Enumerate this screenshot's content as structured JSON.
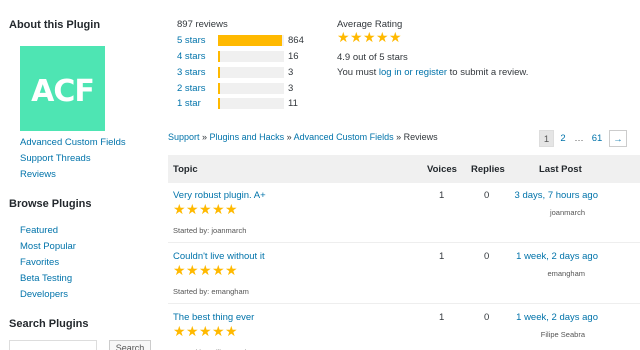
{
  "sidebar": {
    "about_heading": "About this Plugin",
    "logo_text": "ACF",
    "about_links": [
      "Advanced Custom Fields",
      "Support Threads",
      "Reviews"
    ],
    "browse_heading": "Browse Plugins",
    "browse_links": [
      "Featured",
      "Most Popular",
      "Favorites",
      "Beta Testing",
      "Developers"
    ],
    "search_heading": "Search Plugins",
    "search_button": "Search",
    "search_placeholder": ""
  },
  "ratings": {
    "total_label": "897 reviews",
    "rows": [
      {
        "label": "5 stars",
        "count": "864",
        "fraction": 0.963
      },
      {
        "label": "4 stars",
        "count": "16",
        "fraction": 0.018
      },
      {
        "label": "3 stars",
        "count": "3",
        "fraction": 0.003
      },
      {
        "label": "2 stars",
        "count": "3",
        "fraction": 0.003
      },
      {
        "label": "1 star",
        "count": "11",
        "fraction": 0.012
      }
    ],
    "average_heading": "Average Rating",
    "average_stars": 5,
    "average_text": "4.9 out of 5 stars",
    "login_prefix": "You must ",
    "login_link": "log in or register",
    "login_suffix": " to submit a review."
  },
  "breadcrumb": {
    "items": [
      "Support",
      "Plugins and Hacks",
      "Advanced Custom Fields"
    ],
    "separator": " » ",
    "current": "Reviews"
  },
  "pagination": {
    "pages": [
      "1",
      "2",
      "…",
      "61"
    ],
    "current": "1",
    "next": "→"
  },
  "table": {
    "headers": {
      "topic": "Topic",
      "voices": "Voices",
      "replies": "Replies",
      "last_post": "Last Post"
    },
    "started_by_label": "Started by:",
    "rows": [
      {
        "title": "Very robust plugin. A+",
        "stars": 5,
        "author": "joanmarch",
        "voices": "1",
        "replies": "0",
        "last_post": "3 days, 7 hours ago",
        "last_author": "joanmarch"
      },
      {
        "title": "Couldn't live without it",
        "stars": 5,
        "author": "emangham",
        "voices": "1",
        "replies": "0",
        "last_post": "1 week, 2 days ago",
        "last_author": "emangham"
      },
      {
        "title": "The best thing ever",
        "stars": 5,
        "author": "Filipe Seabra",
        "voices": "1",
        "replies": "0",
        "last_post": "1 week, 2 days ago",
        "last_author": "Filipe Seabra"
      }
    ]
  },
  "colors": {
    "accent": "#0073aa",
    "star": "#ffb900",
    "logo_bg": "#4ee5b3",
    "header_bg": "#f0f0f0"
  }
}
